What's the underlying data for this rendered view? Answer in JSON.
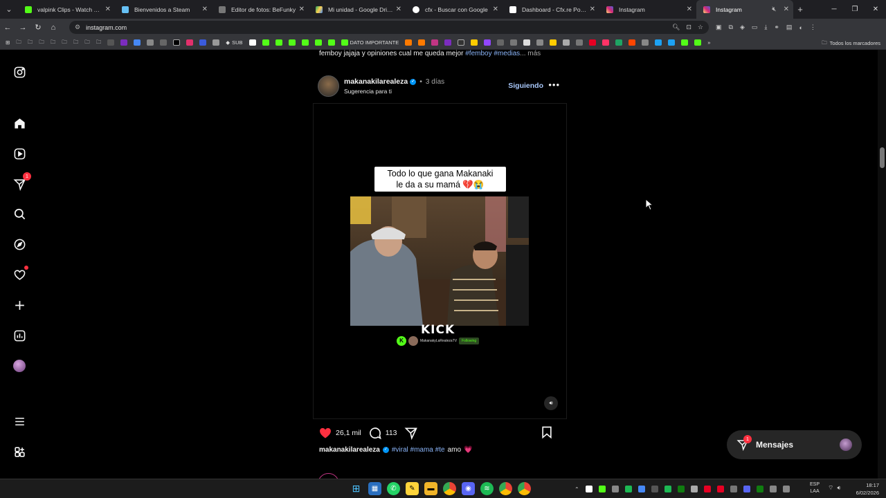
{
  "browser": {
    "tabs": [
      {
        "title": "valpink Clips - Watch Live on",
        "color": "#53fc18"
      },
      {
        "title": "Bienvenidos a Steam",
        "color": "#66c0f4"
      },
      {
        "title": "Editor de fotos: BeFunky",
        "color": "#777777"
      },
      {
        "title": "Mi unidad - Google Drive",
        "color": "#1fa463"
      },
      {
        "title": "cfx - Buscar con Google",
        "color": "#ffffff"
      },
      {
        "title": "Dashboard - Cfx.re Portal",
        "color": "#ffffff"
      },
      {
        "title": "Instagram",
        "color": "#e1306c"
      },
      {
        "title": "Instagram",
        "color": "#e1306c",
        "active": true
      }
    ],
    "url": "instagram.com",
    "bookmarks_sub": "SUB",
    "bookmarks_important": "DATO IMPORTANTE",
    "bookmarks_all": "Todos los marcadores"
  },
  "feed": {
    "previous_caption": {
      "text": "femboy jajaja y opiniones cual me queda mejor",
      "tags": "#femboy #medias",
      "more": "... más"
    },
    "post": {
      "username": "makanakilarealeza",
      "time": "3 días",
      "subtitle": "Sugerencia para ti",
      "follow_label": "Siguiendo",
      "overlay_line1": "Todo lo que gana Makanaki",
      "overlay_line2": "le da a su mamá 💔😭",
      "kick_logo": "KICK",
      "kick_channel": "MakanakyLaRealezaTV",
      "kick_follow": "Following",
      "likes": "26,1 mil",
      "comments": "113",
      "caption_user": "makanakilarealeza",
      "caption_tags": "#viral #mama #te",
      "caption_text": "amo",
      "caption_emoji": "💗"
    }
  },
  "sidebar": {
    "notification_count": "1"
  },
  "messages": {
    "label": "Mensajes",
    "badge": "1"
  },
  "taskbar": {
    "lang_line1": "ESP",
    "lang_line2": "LAA",
    "time": "18:17",
    "date": "6/02/2026"
  },
  "colors": {
    "accent_link": "#8ab4f8",
    "follow_blue": "#a8c7fa",
    "like_red": "#ff3040",
    "verified_blue": "#0095f6"
  }
}
